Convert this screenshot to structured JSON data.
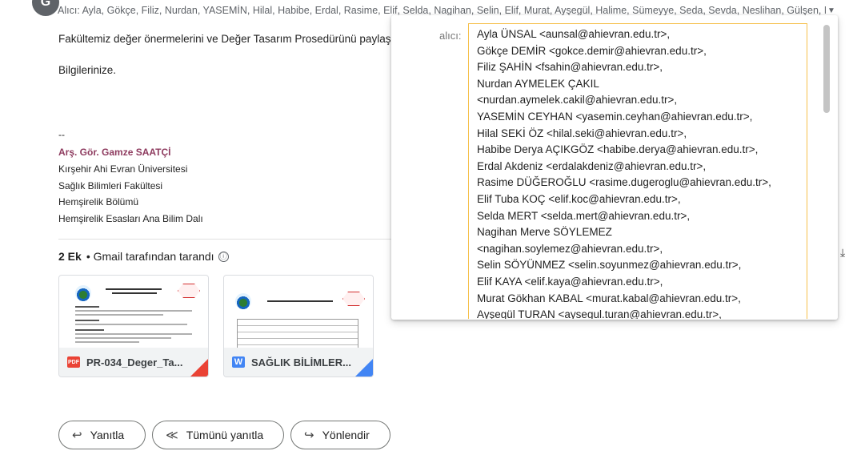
{
  "sender": {
    "avatar_letter": "G"
  },
  "to_summary": "Alıcı: Ayla, Gökçe, Filiz, Nurdan, YASEMİN, Hilal, Habibe, Erdal, Rasime, Elif, Selda, Nagihan, Selin, Elif, Murat, Ayşegül, Halime, Sümeyye, Seda, Sevda, Neslihan, Gülşen, Me",
  "body": {
    "line1": "Fakültemiz değer önermelerini ve Değer Tasarım Prosedürünü paylaş",
    "line2": "Bilgilerinize."
  },
  "signature": {
    "separator": "--",
    "name": "Arş. Gör. Gamze SAATÇİ",
    "lines": [
      "Kırşehir Ahi Evran Üniversitesi",
      "Sağlık Bilimleri Fakültesi",
      "Hemşirelik Bölümü",
      "Hemşirelik Esasları Ana Bilim Dalı"
    ]
  },
  "attachments": {
    "count_label": "2 Ek",
    "scan_label": "• Gmail tarafından tarandı",
    "info_icon": "ⓘ",
    "items": [
      {
        "type_icon": "PDF",
        "name": "PR-034_Deger_Ta...",
        "icon_color": "#ea4335",
        "corner_color": "#ea4335"
      },
      {
        "type_icon": "W",
        "name": "SAĞLIK BİLİMLER...",
        "icon_color": "#4285f4",
        "corner_color": "#4285f4"
      }
    ]
  },
  "recipients_popover": {
    "label": "alıcı:",
    "recipients": [
      "Ayla ÜNSAL <aunsal@ahievran.edu.tr>,",
      "Gökçe DEMİR <gokce.demir@ahievran.edu.tr>,",
      "Filiz ŞAHİN <fsahin@ahievran.edu.tr>,",
      "Nurdan AYMELEK ÇAKIL",
      "<nurdan.aymelek.cakil@ahievran.edu.tr>,",
      "YASEMİN CEYHAN <yasemin.ceyhan@ahievran.edu.tr>,",
      "Hilal SEKİ ÖZ <hilal.seki@ahievran.edu.tr>,",
      "Habibe Derya AÇIKGÖZ <habibe.derya@ahievran.edu.tr>,",
      "Erdal Akdeniz <erdalakdeniz@ahievran.edu.tr>,",
      "Rasime DÜĞEROĞLU <rasime.dugeroglu@ahievran.edu.tr>,",
      "Elif Tuba KOÇ <elif.koc@ahievran.edu.tr>,",
      "Selda MERT <selda.mert@ahievran.edu.tr>,",
      "Nagihan Merve SÖYLEMEZ",
      "<nagihan.soylemez@ahievran.edu.tr>,",
      "Selin SÖYÜNMEZ <selin.soyunmez@ahievran.edu.tr>,",
      "Elif KAYA <elif.kaya@ahievran.edu.tr>,",
      "Murat Gökhan KABAL <murat.kabal@ahievran.edu.tr>,",
      "Ayşegül TURAN <aysegul.turan@ahievran.edu.tr>,"
    ]
  },
  "actions": {
    "reply": {
      "icon": "↩",
      "label": "Yanıtla"
    },
    "reply_all": {
      "icon": "≪",
      "label": "Tümünü yanıtla"
    },
    "forward": {
      "icon": "↪",
      "label": "Yönlendir"
    }
  },
  "icons": {
    "expand": "▼",
    "download": "⤓"
  }
}
